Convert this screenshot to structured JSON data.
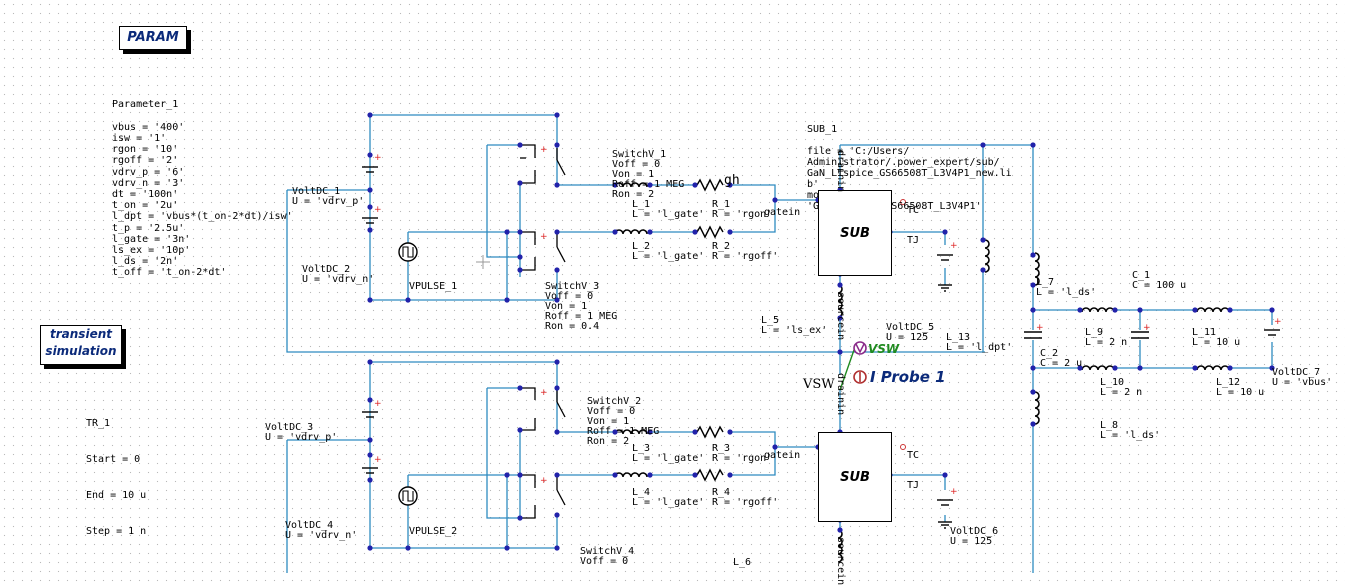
{
  "boxes": {
    "param": "PARAM",
    "transient_line1": "transient",
    "transient_line2": "simulation"
  },
  "parameters": {
    "name": "Parameter_1",
    "lines": [
      "vbus = '400'",
      "isw = '1'",
      "rgon = '10'",
      "rgoff = '2'",
      "vdrv_p = '6'",
      "vdrv_n = '3'",
      "dt = '100n'",
      "t_on = '2u'",
      "l_dpt = 'vbus*(t_on-2*dt)/isw'",
      "t_p = '2.5u'",
      "l_gate = '3n'",
      "ls_ex = '10p'",
      "l_ds = '2n'",
      "t_off = 't_on-2*dt'"
    ]
  },
  "transient": {
    "name": "TR_1",
    "start": "Start = 0",
    "end": "End = 10 u",
    "step": "Step = 1 n"
  },
  "sub": {
    "name": "SUB_1",
    "lines": [
      "file = 'C:/Users/",
      "Administrator/.power_expert/sub/",
      "GaN_LTspice_GS66508T_L3V4P1_new.li",
      "b'",
      "module =",
      "'GaN_LTspice_GS66508T_L3V4P1'"
    ],
    "block_label": "SUB",
    "tc": "TC",
    "tj": "TJ"
  },
  "components": {
    "voltdc1": [
      "VoltDC_1",
      "U = 'vdrv_p'"
    ],
    "voltdc2": [
      "VoltDC_2",
      "U = 'vdrv_n'"
    ],
    "voltdc3": [
      "VoltDC_3",
      "U = 'vdrv_p'"
    ],
    "voltdc4": [
      "VoltDC_4",
      "U = 'vdrv_n'"
    ],
    "voltdc5": [
      "VoltDC_5",
      "U = 125"
    ],
    "voltdc6": [
      "VoltDC_6",
      "U = 125"
    ],
    "voltdc7": [
      "VoltDC_7",
      "U = 'vbus'"
    ],
    "vpulse1": "VPULSE_1",
    "vpulse2": "VPULSE_2",
    "switch1": [
      "SwitchV_1",
      "Voff = 0",
      "Von = 1",
      "Roff = 1 MEG",
      "Ron = 2"
    ],
    "switch2": [
      "SwitchV_2",
      "Voff = 0",
      "Von = 1",
      "Roff = 1 MEG",
      "Ron = 2"
    ],
    "switch3": [
      "SwitchV_3",
      "Voff = 0",
      "Von = 1",
      "Roff = 1 MEG",
      "Ron = 0.4"
    ],
    "switch4": [
      "SwitchV_4",
      "Voff = 0"
    ],
    "l1": [
      "L_1",
      "L = 'l_gate'"
    ],
    "l2": [
      "L_2",
      "L = 'l_gate'"
    ],
    "l3": [
      "L_3",
      "L = 'l_gate'"
    ],
    "l4": [
      "L_4",
      "L = 'l_gate'"
    ],
    "l5": [
      "L_5",
      "L = 'ls_ex'"
    ],
    "l6": "L_6",
    "l7": [
      "L_7",
      "L = 'l_ds'"
    ],
    "l8": [
      "L_8",
      "L = 'l_ds'"
    ],
    "l9": [
      "L_9",
      "L = 2 n"
    ],
    "l10": [
      "L_10",
      "L = 2 n"
    ],
    "l11": [
      "L_11",
      "L = 10 u"
    ],
    "l12": [
      "L_12",
      "L = 10 u"
    ],
    "l13": [
      "L_13",
      "L = 'l_dpt'"
    ],
    "r1": [
      "R_1",
      "R = 'rgon'"
    ],
    "r2": [
      "R_2",
      "R = 'rgoff'"
    ],
    "r3": [
      "R_3",
      "R = 'rgon'"
    ],
    "r4": [
      "R_4",
      "R = 'rgoff'"
    ],
    "c1": [
      "C_1",
      "C = 100 u"
    ],
    "c2": [
      "C_2",
      "C = 2 u"
    ]
  },
  "pins": {
    "gatein": "gatein",
    "sourcein": "sourcein",
    "drainin": "drainin",
    "gh": "gh",
    "vsw": "VSW"
  },
  "probe": "I Probe 1",
  "colors": {
    "wire": "#2e8bc0",
    "node": "#2222aa",
    "box_text": "#0b2a7a",
    "probe_green": "#1f8a1f",
    "plus": "#dd2222"
  }
}
